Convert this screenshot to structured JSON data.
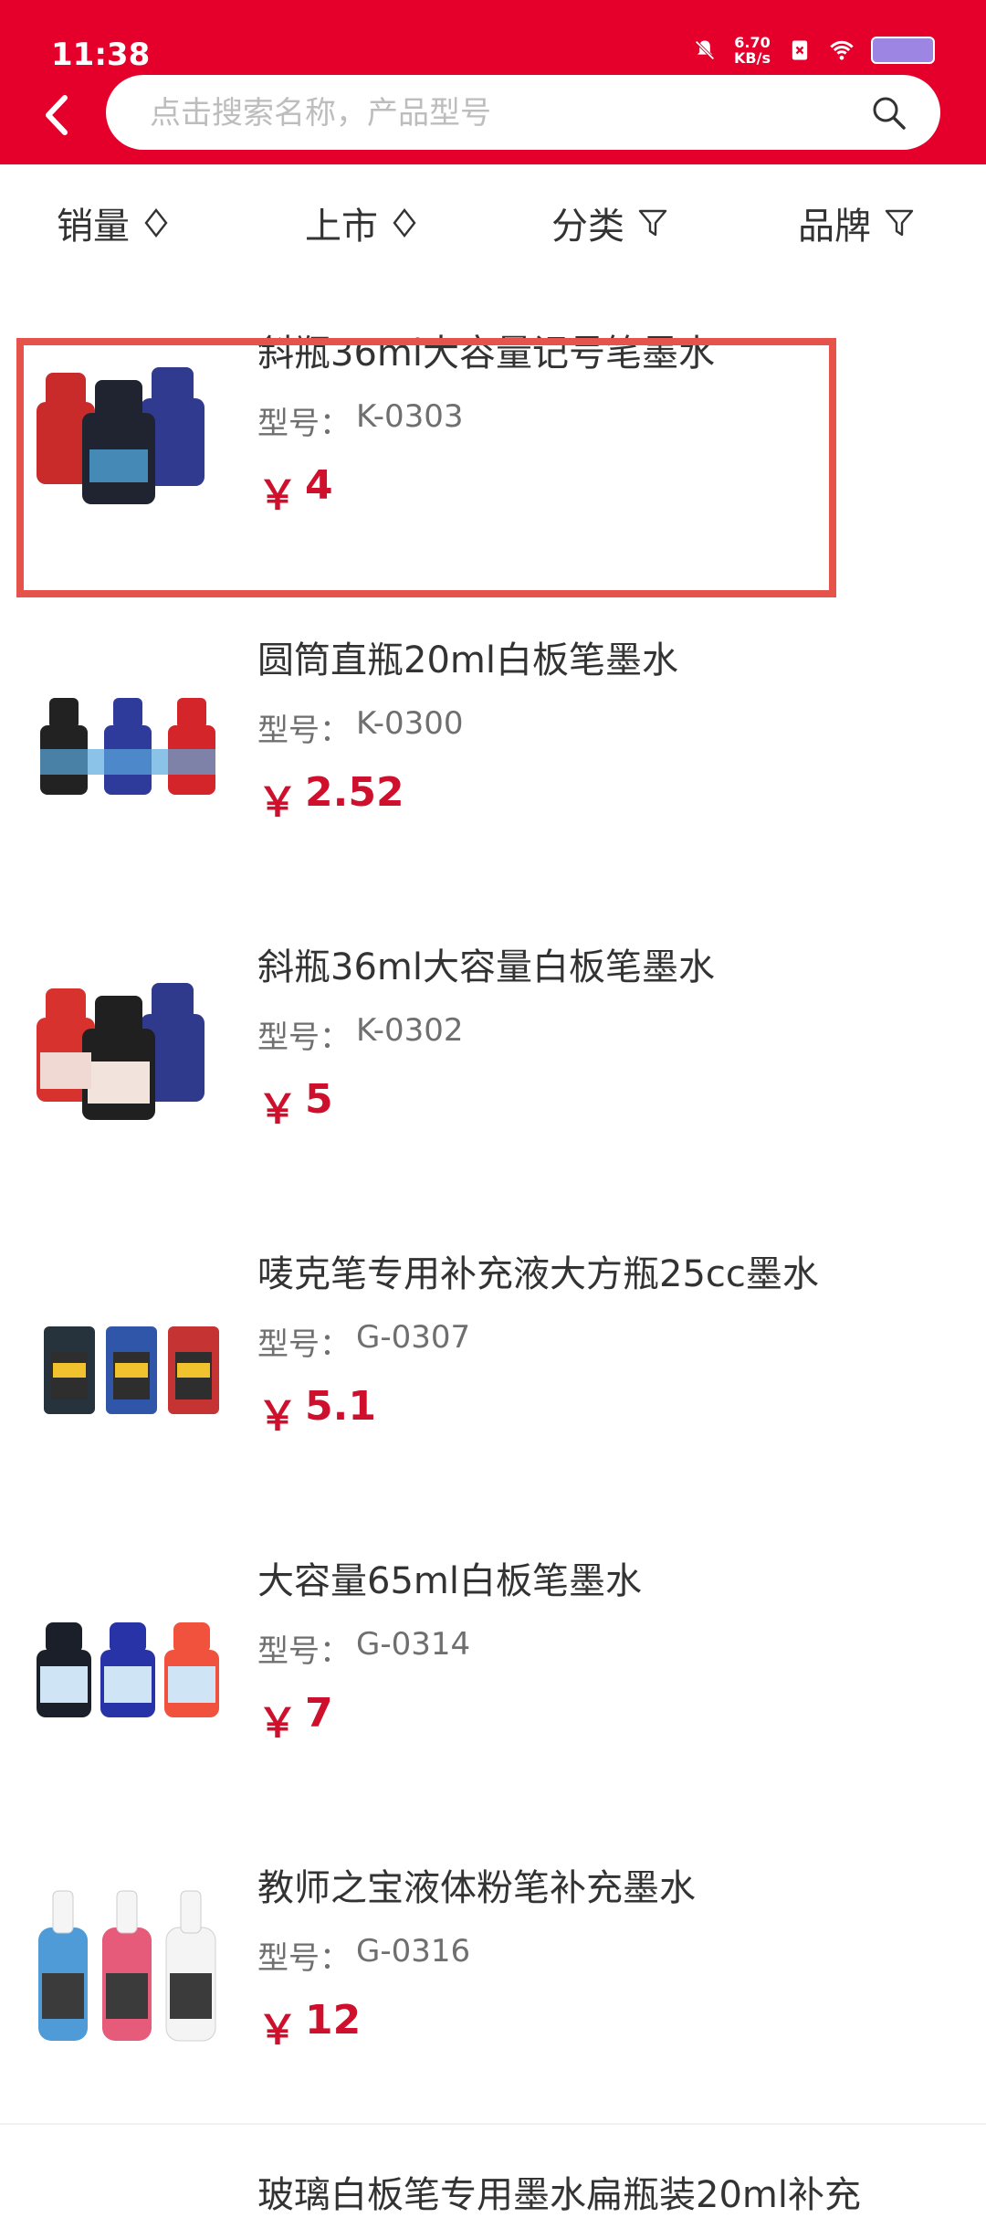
{
  "status_bar": {
    "time": "11:38",
    "network_speed_value": "6.70",
    "network_speed_unit": "KB/s"
  },
  "search": {
    "placeholder": "点击搜索名称，产品型号"
  },
  "filters": [
    {
      "label": "销量",
      "icon": "sort-diamond-icon"
    },
    {
      "label": "上市",
      "icon": "sort-diamond-icon"
    },
    {
      "label": "分类",
      "icon": "filter-funnel-icon"
    },
    {
      "label": "品牌",
      "icon": "filter-funnel-icon"
    }
  ],
  "products": [
    {
      "name": "斜瓶36ml大容量记号笔墨水",
      "model_label": "型号：",
      "model": "K-0303",
      "currency": "￥",
      "price": "4",
      "colors": [
        "#c92a2a",
        "#1f2430",
        "#303a8e"
      ]
    },
    {
      "name": "圆筒直瓶20ml白板笔墨水",
      "model_label": "型号：",
      "model": "K-0300",
      "currency": "￥",
      "price": "2.52",
      "colors": [
        "#222222",
        "#2e3b9a",
        "#d3252a"
      ]
    },
    {
      "name": "斜瓶36ml大容量白板笔墨水",
      "model_label": "型号：",
      "model": "K-0302",
      "currency": "￥",
      "price": "5",
      "colors": [
        "#d7322e",
        "#202020",
        "#2f3a8c"
      ]
    },
    {
      "name": "唛克笔专用补充液大方瓶25cc墨水",
      "model_label": "型号：",
      "model": "G-0307",
      "currency": "￥",
      "price": "5.1",
      "colors": [
        "#26323c",
        "#2f56a8",
        "#c53333"
      ]
    },
    {
      "name": "大容量65ml白板笔墨水",
      "model_label": "型号：",
      "model": "G-0314",
      "currency": "￥",
      "price": "7",
      "colors": [
        "#1b1f29",
        "#2733a6",
        "#f0523e"
      ]
    },
    {
      "name": "教师之宝液体粉笔补充墨水",
      "model_label": "型号：",
      "model": "G-0316",
      "currency": "￥",
      "price": "12",
      "colors": [
        "#4f9bd8",
        "#e65a7a",
        "#f4f4f4"
      ]
    }
  ],
  "partial_item": {
    "name": "玻璃白板笔专用墨水扁瓶装20ml补充"
  },
  "colors": {
    "brand_red": "#e4002b",
    "price_red": "#cf102d",
    "highlight_box": "#e5534b"
  }
}
